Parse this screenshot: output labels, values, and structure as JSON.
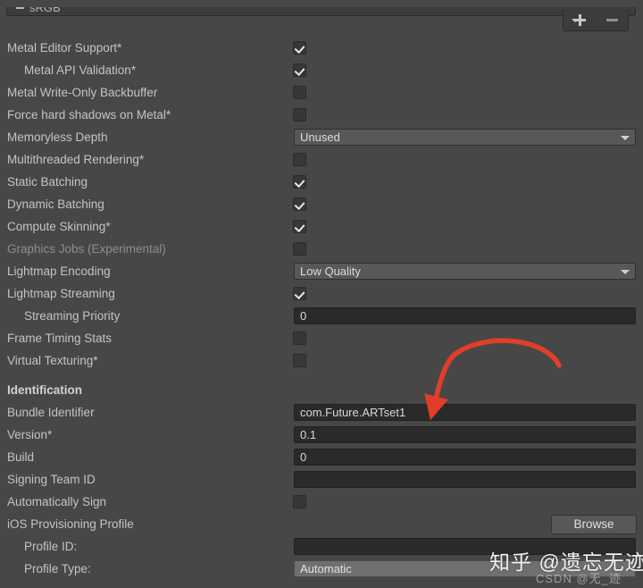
{
  "window": {
    "header_title": "sRGB",
    "add_button_label": "+",
    "remove_button_label": "−"
  },
  "settings": {
    "rows": [
      {
        "label": "Metal Editor Support*",
        "type": "checkbox",
        "checked": true,
        "indent": false
      },
      {
        "label": "Metal API Validation*",
        "type": "checkbox",
        "checked": true,
        "indent": true
      },
      {
        "label": "Metal Write-Only Backbuffer",
        "type": "checkbox",
        "checked": false,
        "indent": false
      },
      {
        "label": "Force hard shadows on Metal*",
        "type": "checkbox",
        "checked": false,
        "indent": false
      },
      {
        "label": "Memoryless Depth",
        "type": "dropdown",
        "value": "Unused",
        "indent": false
      },
      {
        "label": "Multithreaded Rendering*",
        "type": "checkbox",
        "checked": false,
        "indent": false
      },
      {
        "label": "Static Batching",
        "type": "checkbox",
        "checked": true,
        "indent": false
      },
      {
        "label": "Dynamic Batching",
        "type": "checkbox",
        "checked": true,
        "indent": false
      },
      {
        "label": "Compute Skinning*",
        "type": "checkbox",
        "checked": true,
        "indent": false
      },
      {
        "label": "Graphics Jobs (Experimental)",
        "type": "checkbox",
        "checked": false,
        "indent": false,
        "dim": true
      },
      {
        "label": "Lightmap Encoding",
        "type": "dropdown",
        "value": "Low Quality",
        "indent": false
      },
      {
        "label": "Lightmap Streaming",
        "type": "checkbox",
        "checked": true,
        "indent": false
      },
      {
        "label": "Streaming Priority",
        "type": "text",
        "value": "0",
        "indent": true
      },
      {
        "label": "Frame Timing Stats",
        "type": "checkbox",
        "checked": false,
        "indent": false
      },
      {
        "label": "Virtual Texturing*",
        "type": "checkbox",
        "checked": false,
        "indent": false
      },
      {
        "label": "",
        "type": "spacer"
      },
      {
        "label": "Identification",
        "type": "header"
      },
      {
        "label": "Bundle Identifier",
        "type": "text",
        "value": "com.Future.ARTset1",
        "indent": false
      },
      {
        "label": "Version*",
        "type": "text",
        "value": "0.1",
        "indent": false
      },
      {
        "label": "Build",
        "type": "text",
        "value": "0",
        "indent": false
      },
      {
        "label": "Signing Team ID",
        "type": "text",
        "value": "",
        "indent": false
      },
      {
        "label": "Automatically Sign",
        "type": "checkbox",
        "checked": false,
        "indent": false
      },
      {
        "label": "iOS Provisioning Profile",
        "type": "button",
        "value": "Browse",
        "indent": false
      },
      {
        "label": "Profile ID:",
        "type": "text",
        "value": "",
        "indent": true
      },
      {
        "label": "Profile Type:",
        "type": "readonly",
        "value": "Automatic",
        "indent": true
      }
    ]
  },
  "annotation": {
    "arrow_color": "#e03e28",
    "points_to": "Bundle Identifier"
  },
  "watermarks": {
    "zhihu": "知乎 @遗忘无迹",
    "csdn": "CSDN @无_迹"
  }
}
